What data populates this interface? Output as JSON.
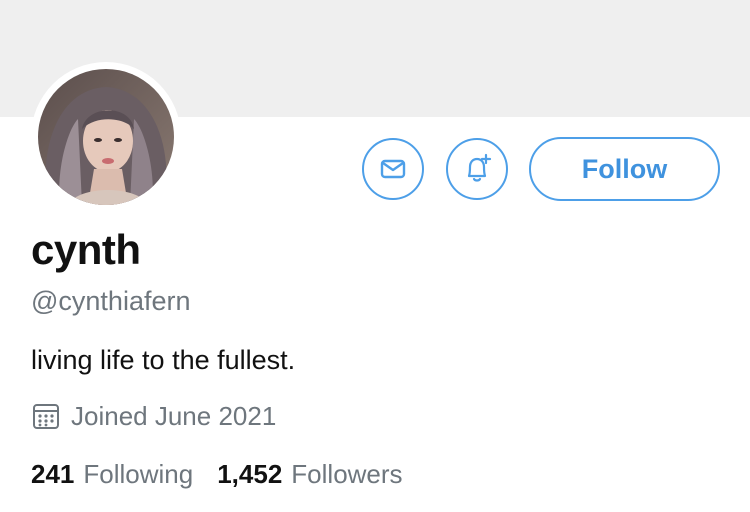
{
  "profile": {
    "display_name": "cynth",
    "handle": "@cynthiafern",
    "bio": "living life to the fullest.",
    "joined": "Joined June 2021"
  },
  "actions": {
    "message_icon": "envelope-icon",
    "notify_icon": "bell-plus-icon",
    "follow_label": "Follow"
  },
  "stats": {
    "following_count": "241",
    "following_label": "Following",
    "followers_count": "1,452",
    "followers_label": "Followers"
  },
  "colors": {
    "accent": "#4d9fe8",
    "banner": "#efefef",
    "secondary_text": "#6e767d"
  }
}
